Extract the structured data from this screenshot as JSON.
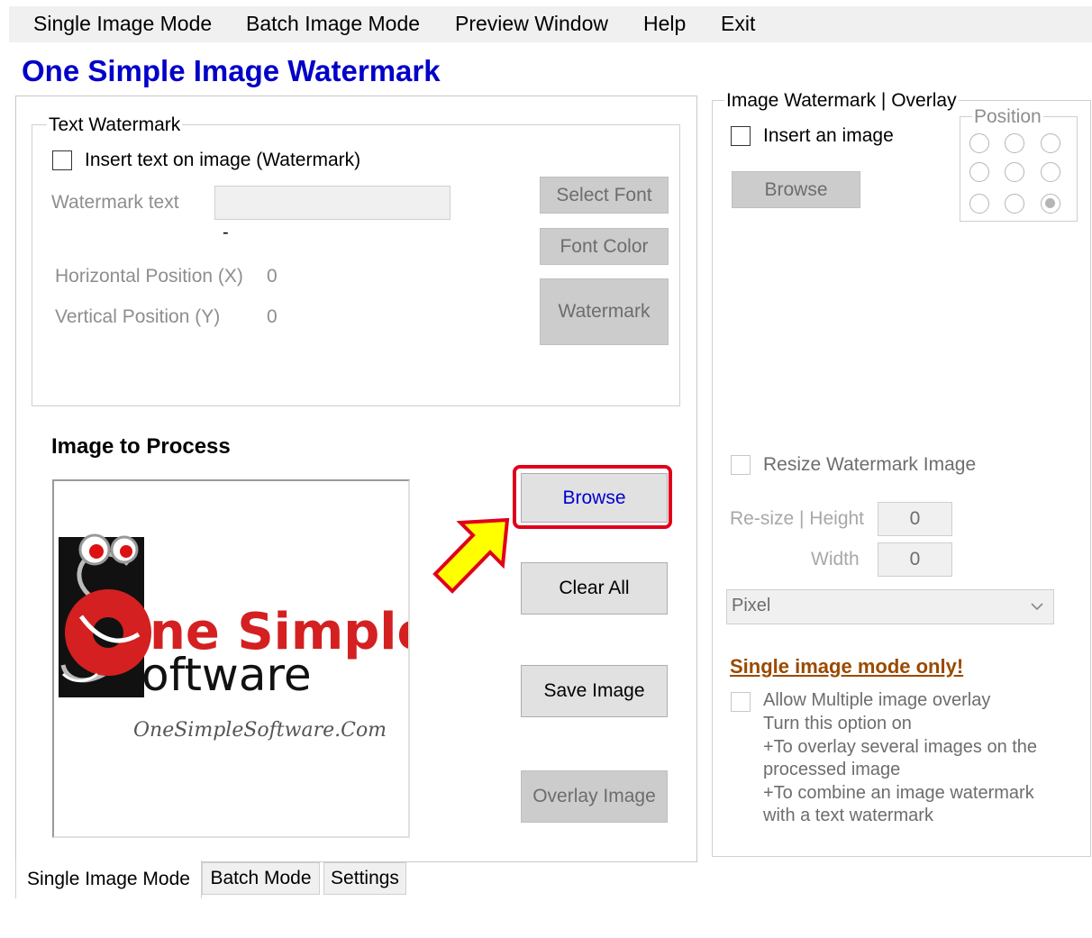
{
  "menu": {
    "items": [
      "Single Image Mode",
      "Batch Image Mode",
      "Preview Window",
      "Help",
      "Exit"
    ]
  },
  "app_title": "One Simple Image Watermark",
  "text_watermark": {
    "group_title": "Text Watermark",
    "insert_checkbox_label": "Insert text on image (Watermark)",
    "watermark_text_label": "Watermark text",
    "watermark_text_value": "",
    "dash": "-",
    "horizontal_label": "Horizontal Position (X)",
    "horizontal_value": "0",
    "vertical_label": "Vertical Position (Y)",
    "vertical_value": "0",
    "select_font_button": "Select Font",
    "font_color_button": "Font Color",
    "watermark_button": "Watermark"
  },
  "image_to_process": {
    "heading": "Image to Process",
    "logo": {
      "top_text": "ne Simple",
      "bottom_text": "oftware",
      "url_text": "OneSimpleSoftware.Com"
    },
    "browse_button": "Browse",
    "clear_all_button": "Clear All",
    "save_image_button": "Save Image",
    "overlay_image_button": "Overlay Image"
  },
  "image_watermark": {
    "group_title": "Image Watermark | Overlay",
    "insert_checkbox_label": "Insert an image",
    "browse_button": "Browse",
    "position_title": "Position",
    "position_selected": 9,
    "resize_checkbox_label": "Resize Watermark Image",
    "resize_height_label": "Re-size | Height",
    "height_value": "0",
    "width_label": "Width",
    "width_value": "0",
    "unit_select_value": "Pixel",
    "single_mode_note": "Single image mode only!",
    "allow_multiple_label": "Allow Multiple image overlay",
    "help_lines": [
      "Turn this option on",
      "+To overlay several images on the",
      "processed image",
      "+To combine an image watermark",
      "with a text watermark"
    ]
  },
  "tabs": [
    "Single Image Mode",
    "Batch Mode",
    "Settings"
  ],
  "colors": {
    "title_blue": "#0000c8",
    "highlight_red": "#e0001b",
    "arrow_yellow": "#ffff00",
    "note_brown": "#9a4a00"
  }
}
